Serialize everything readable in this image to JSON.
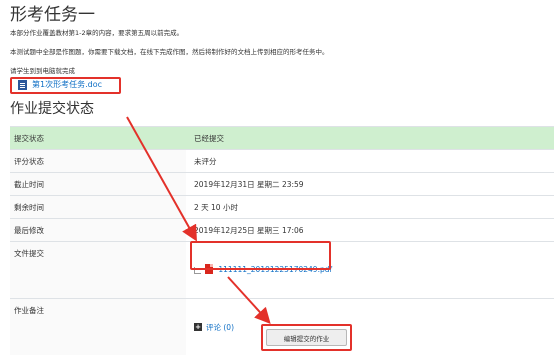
{
  "page": {
    "title": "形考任务一",
    "intro_lines": [
      "本部分作业覆盖教材第1-2章的内容，要求第五周以前完成。",
      "本测试题中全部是作图题，你需要下载文档，在线下完成作图，然后将制作好的文档上传到相应的形考任务中。",
      "请学生到到电脑就完成"
    ],
    "attachment": {
      "filename": "第1次形考任务.doc",
      "icon": "word-doc-icon"
    }
  },
  "submission": {
    "section_title": "作业提交状态",
    "rows": [
      {
        "label": "提交状态",
        "value": "已经提交"
      },
      {
        "label": "评分状态",
        "value": "未评分"
      },
      {
        "label": "截止时间",
        "value": "2019年12月31日 星期二 23:59"
      },
      {
        "label": "剩余时间",
        "value": "2 天 10 小时"
      },
      {
        "label": "最后修改",
        "value": "2019年12月25日 星期三 17:06"
      },
      {
        "label": "文件提交",
        "file": "111111_20191225170249.pdf"
      },
      {
        "label": "作业备注",
        "comment_link": "评论 (0)"
      }
    ],
    "edit_button": "编辑提交的作业"
  },
  "colors": {
    "link": "#0f6fc5",
    "submitted_bg": "#cfefcf",
    "annotation_red": "#e3312a"
  },
  "icons": [
    "word-doc-icon",
    "pdf-icon",
    "plus-icon"
  ]
}
